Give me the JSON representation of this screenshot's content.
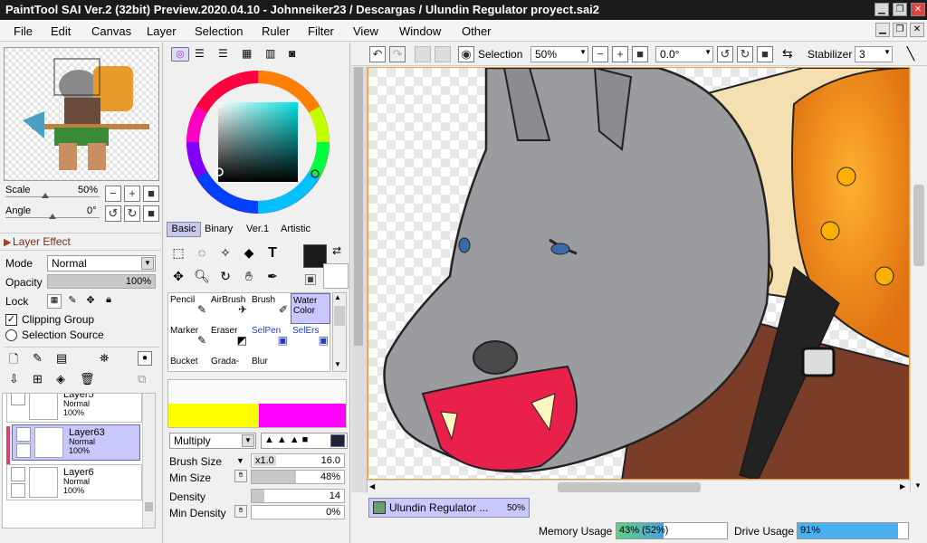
{
  "window": {
    "title": "PaintTool SAI Ver.2 (32bit) Preview.2020.04.10 - Johnneiker23 / Descargas / Ulundin Regulator proyect.sai2"
  },
  "menu": [
    "File",
    "Edit",
    "Canvas",
    "Layer",
    "Selection",
    "Ruler",
    "Filter",
    "View",
    "Window",
    "Other"
  ],
  "navigator": {
    "scale_label": "Scale",
    "scale_value": "50%",
    "angle_label": "Angle",
    "angle_value": "0°"
  },
  "layer_effect": {
    "title": "Layer Effect"
  },
  "layer_props": {
    "mode_label": "Mode",
    "mode_value": "Normal",
    "opacity_label": "Opacity",
    "opacity_value": "100%",
    "opacity_fraction": 1.0,
    "lock_label": "Lock",
    "clipping_label": "Clipping Group",
    "selection_source_label": "Selection Source"
  },
  "layers": [
    {
      "name": "Layer5",
      "mode": "Normal",
      "opacity": "100%"
    },
    {
      "name": "Layer63",
      "mode": "Normal",
      "opacity": "100%"
    },
    {
      "name": "Layer6",
      "mode": "Normal",
      "opacity": "100%"
    }
  ],
  "color_tabs": [
    "Basic",
    "Binary",
    "Ver.1",
    "Artistic"
  ],
  "tools": [
    [
      "Pencil",
      "AirBrush",
      "Brush",
      "Water\nColor"
    ],
    [
      "Marker",
      "Eraser",
      "SelPen",
      "SelErs"
    ],
    [
      "Bucket",
      "Grada-",
      "Blur",
      ""
    ]
  ],
  "brush": {
    "blend_mode": "Multiply",
    "size_label": "Brush Size",
    "size_multiplier": "x1.0",
    "size_value": "16.0",
    "min_size_label": "Min Size",
    "min_size_value": "48%",
    "min_size_fraction": 0.48,
    "density_label": "Density",
    "density_value": "14",
    "density_fraction": 0.14,
    "min_density_label": "Min Density",
    "min_density_value": "0%",
    "min_density_fraction": 0.0
  },
  "toolbar": {
    "selection_label": "Selection",
    "zoom_value": "50%",
    "rotation_value": "0.0°",
    "stabilizer_label": "Stabilizer",
    "stabilizer_value": "3"
  },
  "document_tab": {
    "name": "Ulundin Regulator ...",
    "zoom": "50%"
  },
  "status": {
    "memory_label": "Memory Usage",
    "memory_value": "43% (52%)",
    "memory_fraction": 0.43,
    "drive_label": "Drive Usage",
    "drive_value": "91%",
    "drive_fraction": 0.91
  },
  "colors": {
    "primary": "#1a1a1a",
    "secondary": "#ffffff",
    "swatch_yellow": "#ffff00",
    "swatch_magenta": "#ff00ff",
    "accent_selection": "#c8c8ff"
  }
}
